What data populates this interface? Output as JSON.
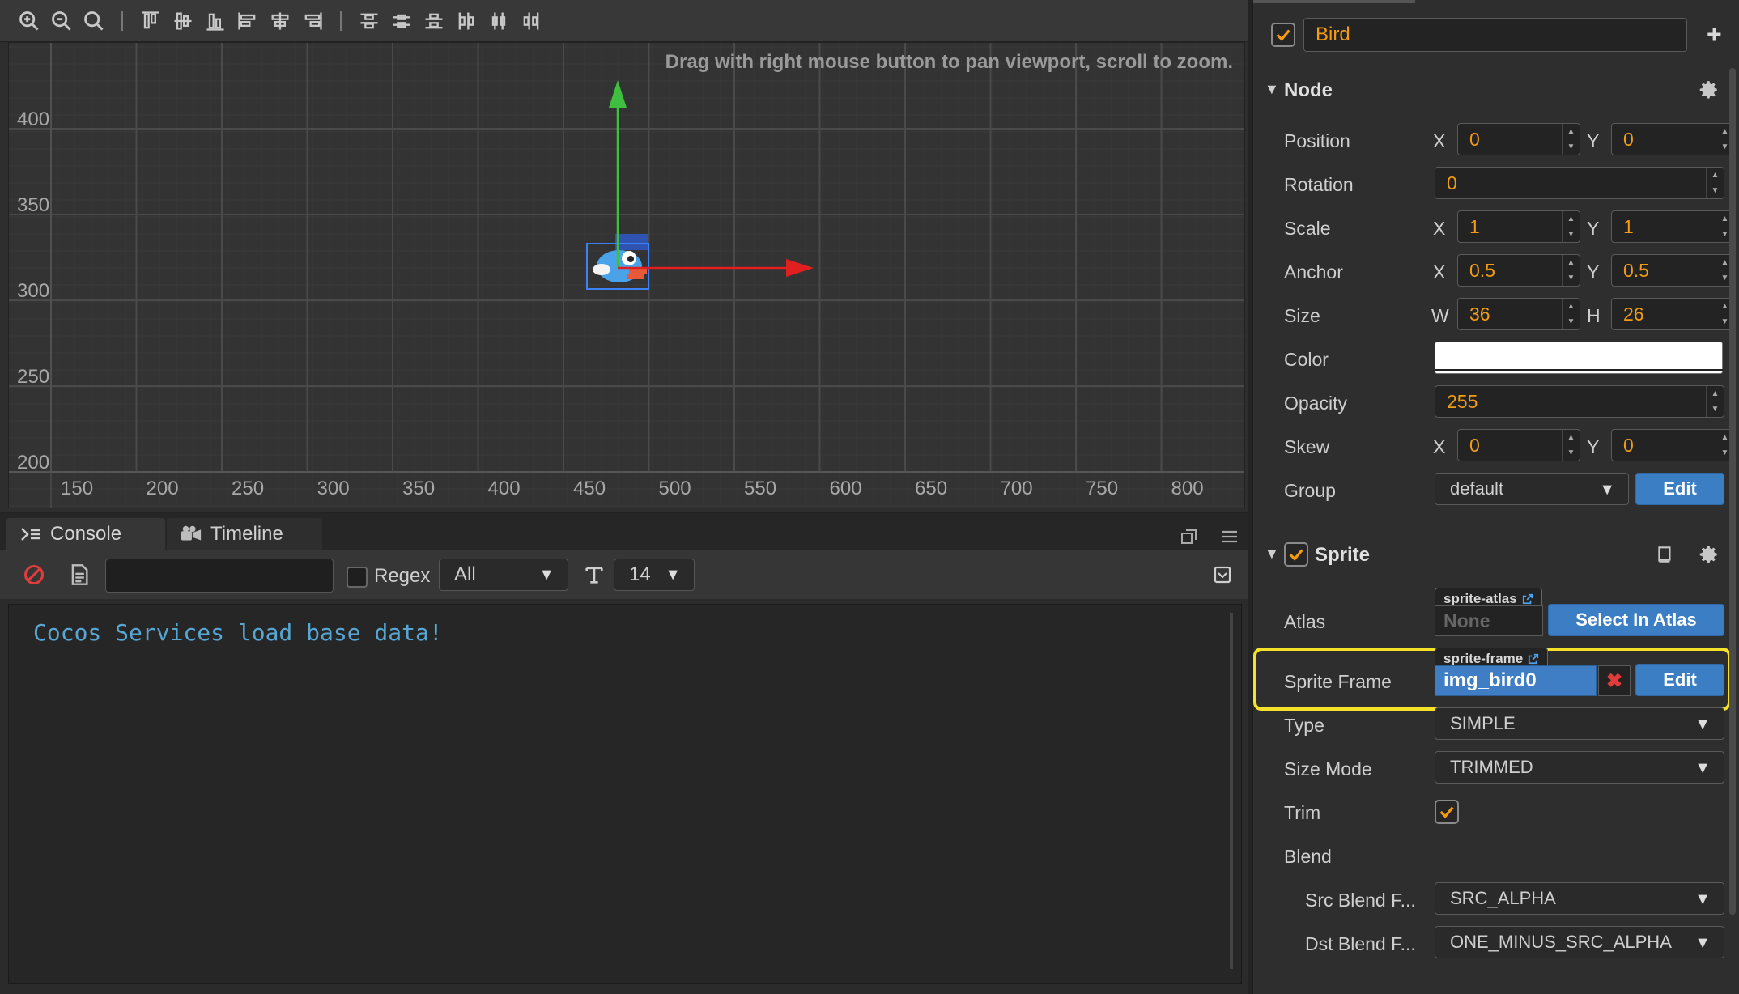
{
  "scene": {
    "hint": "Drag with right mouse button to pan viewport, scroll to zoom.",
    "y_labels": [
      "400",
      "350",
      "300",
      "250",
      "200"
    ],
    "x_labels": [
      "150",
      "200",
      "250",
      "300",
      "350",
      "400",
      "450",
      "500",
      "550",
      "600",
      "650",
      "700",
      "750",
      "800"
    ],
    "toolbar_icons": [
      "zoom-in-icon",
      "zoom-out-icon",
      "zoom-reset-icon",
      "align-top-icon",
      "align-v-center-icon",
      "align-bottom-icon",
      "align-left-icon",
      "align-h-center-icon",
      "align-right-icon",
      "distribute-top-icon",
      "distribute-v-center-icon",
      "distribute-bottom-icon",
      "distribute-left-icon",
      "distribute-h-center-icon",
      "distribute-right-icon"
    ]
  },
  "console": {
    "tabs": [
      {
        "label": "Console",
        "icon": "console-icon"
      },
      {
        "label": "Timeline",
        "icon": "timeline-icon"
      }
    ],
    "filter_value": "",
    "regex_label": "Regex",
    "log_level": "All",
    "font_size": "14",
    "output": "Cocos Services load base data!"
  },
  "inspector": {
    "node_name": "Bird",
    "node_section": {
      "title": "Node",
      "position": {
        "label": "Position",
        "x": "0",
        "y": "0"
      },
      "rotation": {
        "label": "Rotation",
        "value": "0"
      },
      "scale": {
        "label": "Scale",
        "x": "1",
        "y": "1"
      },
      "anchor": {
        "label": "Anchor",
        "x": "0.5",
        "y": "0.5"
      },
      "size": {
        "label": "Size",
        "w": "36",
        "h": "26"
      },
      "color": {
        "label": "Color",
        "value": "#ffffff"
      },
      "opacity": {
        "label": "Opacity",
        "value": "255"
      },
      "skew": {
        "label": "Skew",
        "x": "0",
        "y": "0"
      },
      "group": {
        "label": "Group",
        "value": "default",
        "edit": "Edit"
      }
    },
    "axis": {
      "x": "X",
      "y": "Y",
      "w": "W",
      "h": "H"
    },
    "sprite_section": {
      "title": "Sprite",
      "atlas": {
        "label": "Atlas",
        "tag": "sprite-atlas",
        "value": "None",
        "button": "Select In Atlas"
      },
      "sprite_frame": {
        "label": "Sprite Frame",
        "tag": "sprite-frame",
        "value": "img_bird0",
        "button": "Edit"
      },
      "type": {
        "label": "Type",
        "value": "SIMPLE"
      },
      "size_mode": {
        "label": "Size Mode",
        "value": "TRIMMED"
      },
      "trim": {
        "label": "Trim",
        "checked": true
      },
      "blend": {
        "label": "Blend"
      },
      "src_blend": {
        "label": "Src Blend F...",
        "value": "SRC_ALPHA"
      },
      "dst_blend": {
        "label": "Dst Blend F...",
        "value": "ONE_MINUS_SRC_ALPHA"
      }
    }
  },
  "colors": {
    "accent_orange": "#f39c12",
    "button_blue": "#3c7ec3",
    "highlight_yellow": "#f5e02a",
    "console_text": "#58a6d3"
  }
}
